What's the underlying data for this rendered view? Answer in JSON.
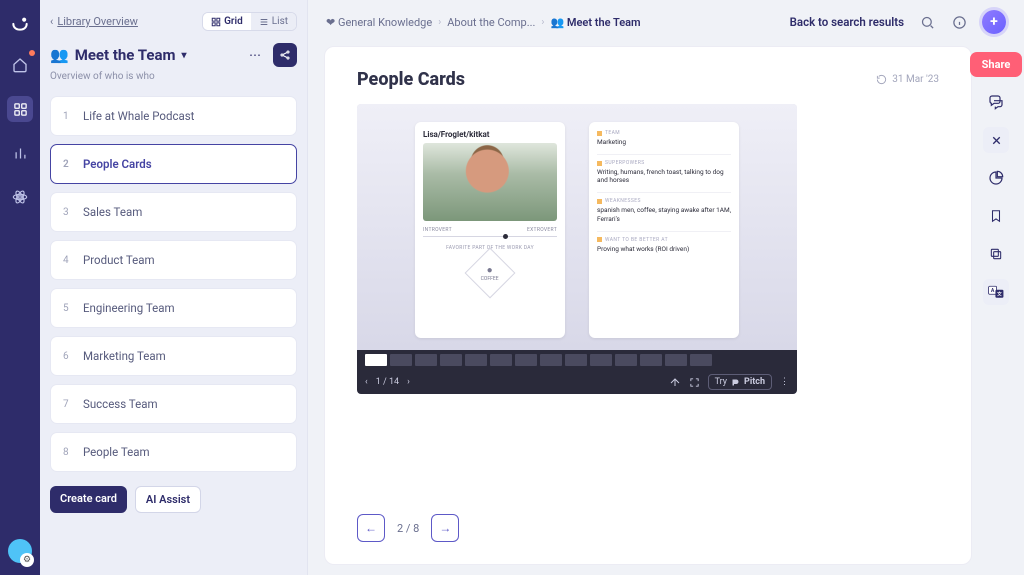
{
  "rail": {
    "items": [
      "smile-logo",
      "home",
      "apps",
      "analytics",
      "atom"
    ]
  },
  "sidebar": {
    "back_label": "Library Overview",
    "view_grid": "Grid",
    "view_list": "List",
    "title_emoji": "👥",
    "title": "Meet the Team",
    "subtitle": "Overview of who is who",
    "items": [
      {
        "n": "1",
        "label": "Life at Whale Podcast"
      },
      {
        "n": "2",
        "label": "People Cards"
      },
      {
        "n": "3",
        "label": "Sales Team"
      },
      {
        "n": "4",
        "label": "Product Team"
      },
      {
        "n": "5",
        "label": "Engineering Team"
      },
      {
        "n": "6",
        "label": "Marketing Team"
      },
      {
        "n": "7",
        "label": "Success Team"
      },
      {
        "n": "8",
        "label": "People Team"
      }
    ],
    "create_card": "Create card",
    "ai_assist": "AI Assist"
  },
  "breadcrumbs": [
    {
      "label": "❤ General Knowledge",
      "truncated": false
    },
    {
      "label": "About the Comp...",
      "truncated": true
    },
    {
      "label": "👥 Meet the Team",
      "truncated": false,
      "current": true
    }
  ],
  "top": {
    "back_link": "Back to search results"
  },
  "doc": {
    "title": "People Cards",
    "date": "31 Mar '23",
    "share": "Share"
  },
  "embed": {
    "card_left": {
      "name": "Lisa/Froglet/kitkat",
      "scale_left": "INTROVERT",
      "scale_right": "EXTROVERT",
      "fav_label": "FAVORITE PART OF THE WORK DAY",
      "fav_emoji": "●",
      "fav_word": "COFFEE"
    },
    "card_right": {
      "sections": [
        {
          "label": "TEAM",
          "value": "Marketing"
        },
        {
          "label": "SUPERPOWERS",
          "value": "Writing, humans, french toast, talking to dog and horses"
        },
        {
          "label": "WEAKNESSES",
          "value": "spanish men, coffee, staying awake after 1AM, Ferrari's"
        },
        {
          "label": "WANT TO BE BETTER AT",
          "value": "Proving what works (ROI driven)"
        }
      ]
    },
    "slide_state": "1 / 14",
    "total_thumbs": 14,
    "try_label": "Try",
    "brand": "Pitch"
  },
  "pager": {
    "state": "2 / 8"
  }
}
